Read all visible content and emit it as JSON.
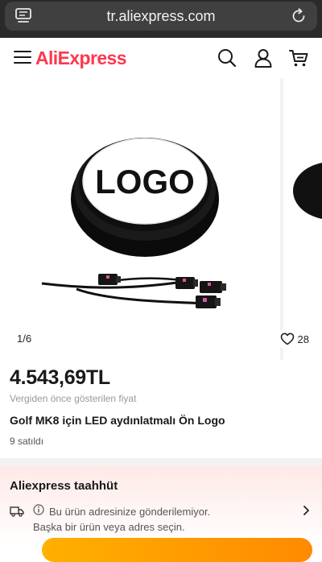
{
  "browser": {
    "url": "tr.aliexpress.com"
  },
  "header": {
    "logo_text": "AliExpress",
    "brand_color": "#fd384f",
    "icons": [
      "menu-icon",
      "search-icon",
      "account-icon",
      "cart-icon"
    ]
  },
  "gallery": {
    "logo_text": "LOGO",
    "page_counter": "1/6",
    "wishlist_count": "28"
  },
  "product": {
    "price": "4.543,69TL",
    "pre_discount_note": "Vergiden önce gösterilen fiyat",
    "title": "Golf MK8 için LED aydınlatmalı Ön Logo",
    "sold_count": "9 satıldı"
  },
  "commitment": {
    "title": "Aliexpress taahhüt",
    "shipping_line1": "Bu ürün adresinize gönderilemiyor.",
    "shipping_line2": "Başka bir ürün veya adres seçin.",
    "accent_color": "#ff8a00"
  }
}
